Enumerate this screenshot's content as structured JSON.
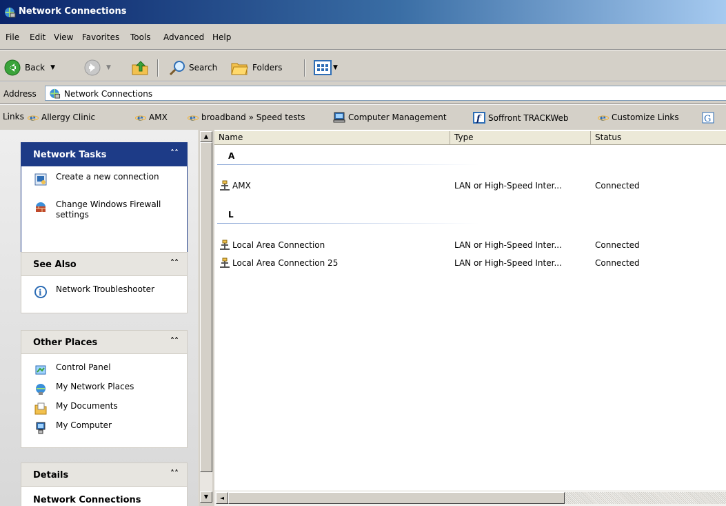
{
  "window": {
    "title": "Network Connections"
  },
  "menu": [
    "File",
    "Edit",
    "View",
    "Favorites",
    "Tools",
    "Advanced",
    "Help"
  ],
  "toolbar": {
    "back_label": "Back",
    "search_label": "Search",
    "folders_label": "Folders"
  },
  "address": {
    "label": "Address",
    "value": "Network Connections"
  },
  "links": {
    "label": "Links",
    "items": [
      "Allergy Clinic",
      "AMX",
      "broadband » Speed tests",
      "Computer Management",
      "Soffront TRACKWeb",
      "Customize Links"
    ]
  },
  "taskpane": {
    "network_tasks": {
      "title": "Network Tasks",
      "items": [
        "Create a new connection",
        "Change Windows Firewall settings"
      ]
    },
    "see_also": {
      "title": "See Also",
      "items": [
        "Network Troubleshooter"
      ]
    },
    "other_places": {
      "title": "Other Places",
      "items": [
        "Control Panel",
        "My Network Places",
        "My Documents",
        "My Computer"
      ]
    },
    "details": {
      "title": "Details",
      "subtitle": "Network Connections"
    }
  },
  "list": {
    "columns": [
      "Name",
      "Type",
      "Status"
    ],
    "groups": [
      {
        "letter": "A",
        "rows": [
          {
            "name": "AMX",
            "type": "LAN or High-Speed Inter...",
            "status": "Connected"
          }
        ]
      },
      {
        "letter": "L",
        "rows": [
          {
            "name": "Local Area Connection",
            "type": "LAN or High-Speed Inter...",
            "status": "Connected"
          },
          {
            "name": "Local Area Connection 25",
            "type": "LAN or High-Speed Inter...",
            "status": "Connected"
          }
        ]
      }
    ]
  },
  "colors": {
    "title_start": "#0a246a",
    "title_end": "#a6caf0",
    "task_header": "#1d3b87",
    "link_blue": "#215dc6"
  },
  "icons": [
    "network-connections-icon",
    "back-icon",
    "forward-icon",
    "up-folder-icon",
    "search-icon",
    "folders-icon",
    "views-icon",
    "ie-icon",
    "computer-management-icon",
    "soffront-icon",
    "google-icon",
    "new-connection-icon",
    "firewall-icon",
    "troubleshooter-icon",
    "control-panel-icon",
    "network-places-icon",
    "my-documents-icon",
    "my-computer-icon",
    "lan-icon"
  ]
}
